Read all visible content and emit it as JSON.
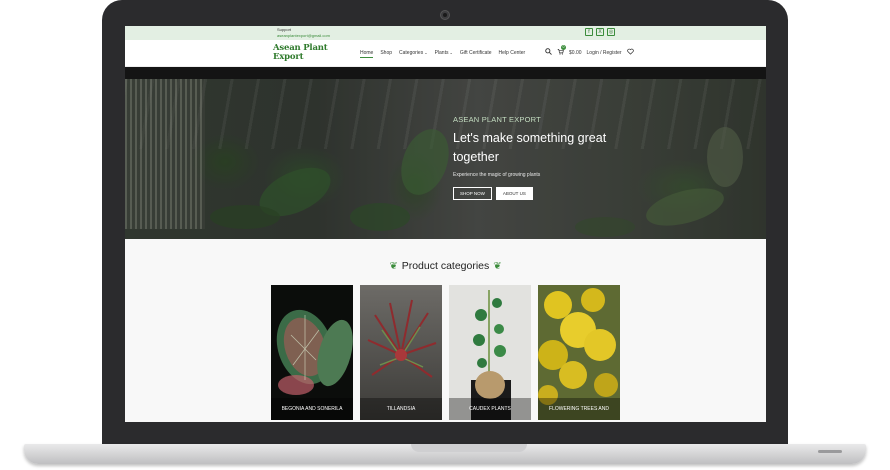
{
  "topbar": {
    "support_label": "Support",
    "support_email": "aseanplantexport@gmail.com",
    "social": [
      "f",
      "X",
      "◎"
    ]
  },
  "navbar": {
    "logo_line1": "Asean Plant",
    "logo_line2": "Export",
    "menu": [
      "Home",
      "Shop",
      "Categories",
      "Plants",
      "Gift Certificate",
      "Help Center"
    ],
    "menu_chevrons": [
      "",
      "",
      "⌄",
      "⌄",
      "",
      ""
    ],
    "cart_total": "$0.00",
    "cart_count": "0",
    "login_label": "Login / Register"
  },
  "hero": {
    "kicker": "ASEAN PLANT EXPORT",
    "title": "Let's make something great together",
    "subtitle": "Experience the magic of growing plants",
    "shop_button": "SHOP NOW",
    "about_button": "ABOUT US"
  },
  "categories": {
    "heading": "Product categories",
    "items": [
      {
        "label": "BEGONIA AND SONERILA"
      },
      {
        "label": "TILLANDSIA"
      },
      {
        "label": "CAUDEX PLANTS"
      },
      {
        "label": "FLOWERING TREES AND SHRUBS"
      }
    ]
  },
  "colors": {
    "brand_green": "#2f7a2c",
    "topbar_bg": "#e3efe3",
    "laptop_frame": "#2b2b2d"
  }
}
